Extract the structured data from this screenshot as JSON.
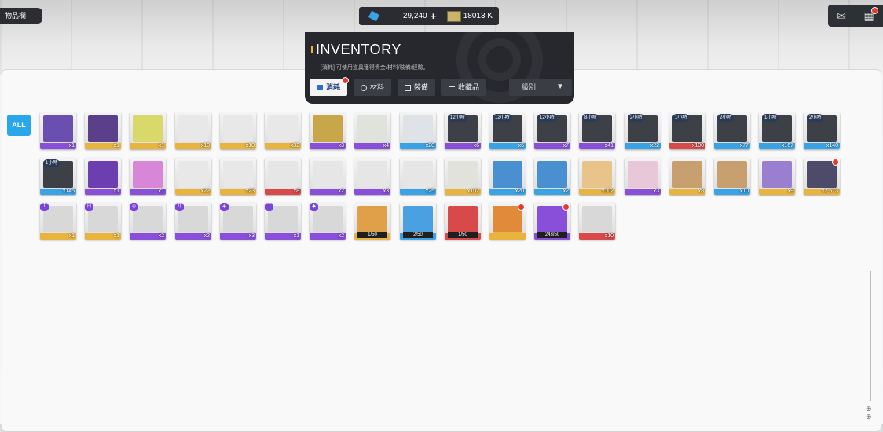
{
  "window": {
    "title": "物品欄"
  },
  "currency": {
    "gems": "29,240",
    "plus": "+",
    "credits": "18013 K"
  },
  "topright": {
    "mail_icon": "mail-icon",
    "menu_icon": "grid-menu-icon"
  },
  "inventory": {
    "title": "INVENTORY",
    "description": "[消耗] 可使用道具獲得資金/材料/裝備/經驗。",
    "tabs": [
      {
        "label": "消耗",
        "icon": "list-icon",
        "active": true,
        "has_dot": true
      },
      {
        "label": "材料",
        "icon": "gear-icon",
        "active": false
      },
      {
        "label": "裝備",
        "icon": "equipment-icon",
        "active": false
      },
      {
        "label": "收藏品",
        "icon": "collection-icon",
        "active": false
      }
    ],
    "sort": {
      "label": "級別",
      "arrow": "▼"
    }
  },
  "filter": {
    "all_label": "ALL"
  },
  "colors": {
    "gold": "#e9b43d",
    "purple": "#8a4fd8",
    "blue": "#3aa3e6",
    "red": "#d84a4a",
    "panel": "#26282d"
  },
  "rows": [
    [
      {
        "art": "#6b4fb0",
        "rarity": "purple",
        "qty": "x1"
      },
      {
        "art": "#5a3f8a",
        "rarity": "gold",
        "qty": "x1"
      },
      {
        "art": "#d9d86b",
        "rarity": "gold",
        "qty": "x1"
      },
      {
        "art": "#e8e8e8",
        "rarity": "gold",
        "qty": "x10"
      },
      {
        "art": "#e8e8e8",
        "rarity": "gold",
        "qty": "x10"
      },
      {
        "art": "#e8e8e8",
        "rarity": "gold",
        "qty": "x32"
      },
      {
        "art": "#c8a64a",
        "rarity": "purple",
        "qty": "x3"
      },
      {
        "art": "#dfe3dc",
        "rarity": "purple",
        "qty": "x4"
      },
      {
        "art": "#dfe3e8",
        "rarity": "blue",
        "qty": "x20"
      },
      {
        "art": "#3e4048",
        "rarity": "purple",
        "qty": "x6",
        "badge": "12小時"
      },
      {
        "art": "#3e4048",
        "rarity": "blue",
        "qty": "x6",
        "badge": "12小時"
      },
      {
        "art": "#3e4048",
        "rarity": "purple",
        "qty": "x7",
        "badge": "12小時"
      },
      {
        "art": "#3e4048",
        "rarity": "purple",
        "qty": "x41",
        "badge": "8小時"
      },
      {
        "art": "#3e4048",
        "rarity": "blue",
        "qty": "x22",
        "badge": "2小時"
      },
      {
        "art": "#3e4048",
        "rarity": "red",
        "qty": "x100",
        "badge": "1小時"
      },
      {
        "art": "#3e4048",
        "rarity": "blue",
        "qty": "x77",
        "badge": "2小時"
      },
      {
        "art": "#3e4048",
        "rarity": "blue",
        "qty": "x167",
        "badge": "1小時"
      },
      {
        "art": "#3e4048",
        "rarity": "blue",
        "qty": "x140",
        "badge": "2小時"
      }
    ],
    [
      {
        "art": "#3e4048",
        "rarity": "blue",
        "qty": "x145",
        "badge": "1小時"
      },
      {
        "art": "#6b3fb0",
        "rarity": "purple",
        "qty": "x1"
      },
      {
        "art": "#d887d8",
        "rarity": "purple",
        "qty": "x1"
      },
      {
        "art": "#e8e8e8",
        "rarity": "gold",
        "qty": "x22"
      },
      {
        "art": "#e8e8e8",
        "rarity": "gold",
        "qty": "x23"
      },
      {
        "art": "#e6e6e6",
        "rarity": "red",
        "qty": "x8"
      },
      {
        "art": "#e6e6e6",
        "rarity": "purple",
        "qty": "x2"
      },
      {
        "art": "#e6e6e6",
        "rarity": "purple",
        "qty": "x3"
      },
      {
        "art": "#e6e6e6",
        "rarity": "blue",
        "qty": "x25"
      },
      {
        "art": "#e2e2dc",
        "rarity": "gold",
        "qty": "x102"
      },
      {
        "art": "#4a8fd0",
        "rarity": "blue",
        "qty": "x20"
      },
      {
        "art": "#4a8fd0",
        "rarity": "blue",
        "qty": "x2"
      },
      {
        "art": "#e8c48a",
        "rarity": "gold",
        "qty": "x102"
      },
      {
        "art": "#e8c8d8",
        "rarity": "purple",
        "qty": "x3"
      },
      {
        "art": "#c8a070",
        "rarity": "gold",
        "qty": "x8"
      },
      {
        "art": "#c8a070",
        "rarity": "blue",
        "qty": "x10"
      },
      {
        "art": "#9a7fd0",
        "rarity": "gold",
        "qty": "x9"
      },
      {
        "art": "#4e4a6a",
        "rarity": "gold",
        "qty": "x2,573",
        "dot": true
      }
    ],
    [
      {
        "art": "#d8d8d8",
        "rarity": "gold",
        "qty": "x1",
        "hex": "工"
      },
      {
        "art": "#d8d8d8",
        "rarity": "gold",
        "qty": "x1",
        "hex": "日"
      },
      {
        "art": "#d8d8d8",
        "rarity": "purple",
        "qty": "x2",
        "hex": "◎"
      },
      {
        "art": "#d8d8d8",
        "rarity": "purple",
        "qty": "x2",
        "hex": "几"
      },
      {
        "art": "#d8d8d8",
        "rarity": "purple",
        "qty": "x3",
        "hex": "◈"
      },
      {
        "art": "#d8d8d8",
        "rarity": "purple",
        "qty": "x1",
        "hex": "工"
      },
      {
        "art": "#d8d8d8",
        "rarity": "purple",
        "qty": "x2",
        "hex": "◆"
      },
      {
        "art": "#e0a04a",
        "rarity": "gold",
        "qty": "",
        "progress": "1/50"
      },
      {
        "art": "#4aa0e0",
        "rarity": "blue",
        "qty": "",
        "progress": "2/50"
      },
      {
        "art": "#d84a4a",
        "rarity": "red",
        "qty": "",
        "progress": "1/50"
      },
      {
        "art": "#e08a3a",
        "rarity": "gold",
        "qty": "",
        "progress": "",
        "dot": true,
        "fill": 1.0
      },
      {
        "art": "#8a4fd8",
        "rarity": "purple",
        "qty": "",
        "progress": "243/50",
        "dot": true
      },
      {
        "art": "#d8d8d8",
        "rarity": "red",
        "qty": "x10"
      }
    ]
  ]
}
